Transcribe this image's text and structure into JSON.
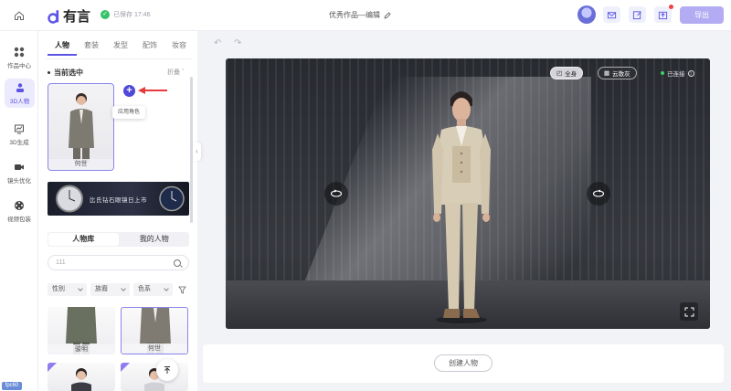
{
  "topbar": {
    "logo_text": "有言",
    "save_status": "已保存 17:46",
    "doc_title": "优秀作品—编辑",
    "export_label": "导出"
  },
  "leftnav": {
    "items": [
      {
        "label": "作品中心"
      },
      {
        "label": "3D人物"
      },
      {
        "label": "3D生成"
      },
      {
        "label": "镜头优化"
      },
      {
        "label": "视频包装"
      }
    ],
    "badge": "fpc60"
  },
  "panel": {
    "tabs": [
      "人物",
      "套装",
      "发型",
      "配饰",
      "妆容"
    ],
    "active_tab": "人物",
    "section_title": "当前选中",
    "fold_label": "折叠",
    "current_character": "何世",
    "tooltip": "应用角色",
    "banner_text": "比氏钻石眼镜日上市",
    "lib_tabs": [
      "人物库",
      "我的人物"
    ],
    "search_value": "111",
    "filters": [
      "性别",
      "族裔",
      "色系"
    ],
    "characters": [
      {
        "name": "骏明",
        "selected": false
      },
      {
        "name": "何世",
        "selected": true
      }
    ]
  },
  "stage": {
    "pills": [
      "全身",
      "云散灰"
    ],
    "connection": "已连接"
  },
  "bottom": {
    "create_label": "创建人物"
  }
}
